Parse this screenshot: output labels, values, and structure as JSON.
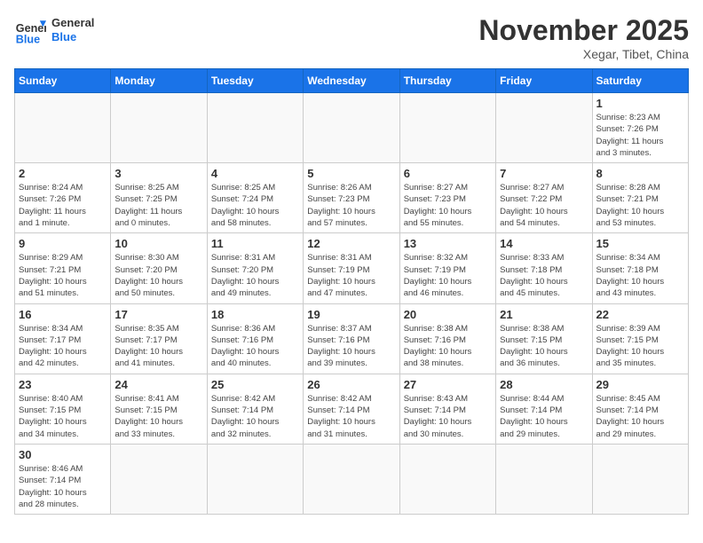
{
  "header": {
    "logo_general": "General",
    "logo_blue": "Blue",
    "month_title": "November 2025",
    "subtitle": "Xegar, Tibet, China"
  },
  "weekdays": [
    "Sunday",
    "Monday",
    "Tuesday",
    "Wednesday",
    "Thursday",
    "Friday",
    "Saturday"
  ],
  "weeks": [
    [
      {
        "day": "",
        "info": ""
      },
      {
        "day": "",
        "info": ""
      },
      {
        "day": "",
        "info": ""
      },
      {
        "day": "",
        "info": ""
      },
      {
        "day": "",
        "info": ""
      },
      {
        "day": "",
        "info": ""
      },
      {
        "day": "1",
        "info": "Sunrise: 8:23 AM\nSunset: 7:26 PM\nDaylight: 11 hours\nand 3 minutes."
      }
    ],
    [
      {
        "day": "2",
        "info": "Sunrise: 8:24 AM\nSunset: 7:26 PM\nDaylight: 11 hours\nand 1 minute."
      },
      {
        "day": "3",
        "info": "Sunrise: 8:25 AM\nSunset: 7:25 PM\nDaylight: 11 hours\nand 0 minutes."
      },
      {
        "day": "4",
        "info": "Sunrise: 8:25 AM\nSunset: 7:24 PM\nDaylight: 10 hours\nand 58 minutes."
      },
      {
        "day": "5",
        "info": "Sunrise: 8:26 AM\nSunset: 7:23 PM\nDaylight: 10 hours\nand 57 minutes."
      },
      {
        "day": "6",
        "info": "Sunrise: 8:27 AM\nSunset: 7:23 PM\nDaylight: 10 hours\nand 55 minutes."
      },
      {
        "day": "7",
        "info": "Sunrise: 8:27 AM\nSunset: 7:22 PM\nDaylight: 10 hours\nand 54 minutes."
      },
      {
        "day": "8",
        "info": "Sunrise: 8:28 AM\nSunset: 7:21 PM\nDaylight: 10 hours\nand 53 minutes."
      }
    ],
    [
      {
        "day": "9",
        "info": "Sunrise: 8:29 AM\nSunset: 7:21 PM\nDaylight: 10 hours\nand 51 minutes."
      },
      {
        "day": "10",
        "info": "Sunrise: 8:30 AM\nSunset: 7:20 PM\nDaylight: 10 hours\nand 50 minutes."
      },
      {
        "day": "11",
        "info": "Sunrise: 8:31 AM\nSunset: 7:20 PM\nDaylight: 10 hours\nand 49 minutes."
      },
      {
        "day": "12",
        "info": "Sunrise: 8:31 AM\nSunset: 7:19 PM\nDaylight: 10 hours\nand 47 minutes."
      },
      {
        "day": "13",
        "info": "Sunrise: 8:32 AM\nSunset: 7:19 PM\nDaylight: 10 hours\nand 46 minutes."
      },
      {
        "day": "14",
        "info": "Sunrise: 8:33 AM\nSunset: 7:18 PM\nDaylight: 10 hours\nand 45 minutes."
      },
      {
        "day": "15",
        "info": "Sunrise: 8:34 AM\nSunset: 7:18 PM\nDaylight: 10 hours\nand 43 minutes."
      }
    ],
    [
      {
        "day": "16",
        "info": "Sunrise: 8:34 AM\nSunset: 7:17 PM\nDaylight: 10 hours\nand 42 minutes."
      },
      {
        "day": "17",
        "info": "Sunrise: 8:35 AM\nSunset: 7:17 PM\nDaylight: 10 hours\nand 41 minutes."
      },
      {
        "day": "18",
        "info": "Sunrise: 8:36 AM\nSunset: 7:16 PM\nDaylight: 10 hours\nand 40 minutes."
      },
      {
        "day": "19",
        "info": "Sunrise: 8:37 AM\nSunset: 7:16 PM\nDaylight: 10 hours\nand 39 minutes."
      },
      {
        "day": "20",
        "info": "Sunrise: 8:38 AM\nSunset: 7:16 PM\nDaylight: 10 hours\nand 38 minutes."
      },
      {
        "day": "21",
        "info": "Sunrise: 8:38 AM\nSunset: 7:15 PM\nDaylight: 10 hours\nand 36 minutes."
      },
      {
        "day": "22",
        "info": "Sunrise: 8:39 AM\nSunset: 7:15 PM\nDaylight: 10 hours\nand 35 minutes."
      }
    ],
    [
      {
        "day": "23",
        "info": "Sunrise: 8:40 AM\nSunset: 7:15 PM\nDaylight: 10 hours\nand 34 minutes."
      },
      {
        "day": "24",
        "info": "Sunrise: 8:41 AM\nSunset: 7:15 PM\nDaylight: 10 hours\nand 33 minutes."
      },
      {
        "day": "25",
        "info": "Sunrise: 8:42 AM\nSunset: 7:14 PM\nDaylight: 10 hours\nand 32 minutes."
      },
      {
        "day": "26",
        "info": "Sunrise: 8:42 AM\nSunset: 7:14 PM\nDaylight: 10 hours\nand 31 minutes."
      },
      {
        "day": "27",
        "info": "Sunrise: 8:43 AM\nSunset: 7:14 PM\nDaylight: 10 hours\nand 30 minutes."
      },
      {
        "day": "28",
        "info": "Sunrise: 8:44 AM\nSunset: 7:14 PM\nDaylight: 10 hours\nand 29 minutes."
      },
      {
        "day": "29",
        "info": "Sunrise: 8:45 AM\nSunset: 7:14 PM\nDaylight: 10 hours\nand 29 minutes."
      }
    ],
    [
      {
        "day": "30",
        "info": "Sunrise: 8:46 AM\nSunset: 7:14 PM\nDaylight: 10 hours\nand 28 minutes."
      },
      {
        "day": "",
        "info": ""
      },
      {
        "day": "",
        "info": ""
      },
      {
        "day": "",
        "info": ""
      },
      {
        "day": "",
        "info": ""
      },
      {
        "day": "",
        "info": ""
      },
      {
        "day": "",
        "info": ""
      }
    ]
  ]
}
